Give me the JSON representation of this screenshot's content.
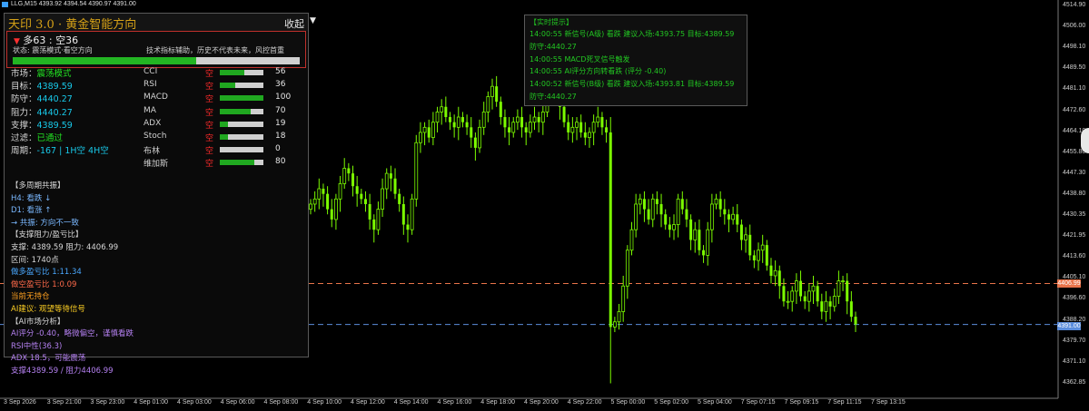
{
  "header": {
    "quote_line": "LLG,M15  4393.92 4394.54 4390.97 4391.00"
  },
  "price_axis": {
    "labels": [
      "4514.90",
      "4506.00",
      "4498.10",
      "4489.50",
      "4481.10",
      "4472.60",
      "4464.10",
      "4455.80",
      "4447.30",
      "4438.80",
      "4430.35",
      "4421.95",
      "4413.60",
      "4405.10",
      "4396.60",
      "4388.20",
      "4379.70",
      "4371.10",
      "4362.85"
    ],
    "tags": [
      {
        "label": "4406.99",
        "color": "#e8734a"
      },
      {
        "label": "4391.00",
        "color": "#5b8ddc"
      }
    ]
  },
  "time_axis": {
    "labels": [
      "3 Sep 2026",
      "3 Sep 21:00",
      "3 Sep 23:00",
      "4 Sep 01:00",
      "4 Sep 03:00",
      "4 Sep 06:00",
      "4 Sep 08:00",
      "4 Sep 10:00",
      "4 Sep 12:00",
      "4 Sep 14:00",
      "4 Sep 16:00",
      "4 Sep 18:00",
      "4 Sep 20:00",
      "4 Sep 22:00",
      "5 Sep 00:00",
      "5 Sep 02:00",
      "5 Sep 04:00",
      "7 Sep 07:15",
      "7 Sep 09:15",
      "7 Sep 11:15",
      "7 Sep 13:15"
    ]
  },
  "info_panel": {
    "title": "天印 3.0 · 黄金智能方向",
    "collapse_label": "收起",
    "dropdown_glyph": "▼",
    "sentiment": {
      "arrow": "▼",
      "ratio": "多63 : 空36",
      "status": "状态: 震荡模式·看空方向",
      "risk_note": "技术指标辅助，历史不代表未来，风控首重",
      "bull_fraction": 0.64
    },
    "summary_rows": [
      {
        "label": "市场：",
        "value": "震荡模式",
        "style": "val-green"
      },
      {
        "label": "目标：",
        "value": "4389.59",
        "style": "val"
      },
      {
        "label": "防守：",
        "value": "4440.27",
        "style": "val"
      },
      {
        "label": "阻力：",
        "value": "4440.27",
        "style": "val"
      },
      {
        "label": "支撑：",
        "value": "4389.59",
        "style": "val"
      },
      {
        "label": "过滤：",
        "value": "已通过",
        "style": "val-green"
      },
      {
        "label": "周期：",
        "value": "-167 | 1H空 4H空",
        "style": "val"
      }
    ],
    "indicators": [
      {
        "name": "CCI",
        "dir": "空",
        "value": "56",
        "fraction": 0.56
      },
      {
        "name": "RSI",
        "dir": "空",
        "value": "36",
        "fraction": 0.36
      },
      {
        "name": "MACD",
        "dir": "空",
        "value": "100",
        "fraction": 1.0
      },
      {
        "name": "MA",
        "dir": "空",
        "value": "70",
        "fraction": 0.7
      },
      {
        "name": "ADX",
        "dir": "空",
        "value": "19",
        "fraction": 0.19
      },
      {
        "name": "Stoch",
        "dir": "空",
        "value": "18",
        "fraction": 0.18
      },
      {
        "name": "布林",
        "dir": "空",
        "value": "0",
        "fraction": 0.0
      },
      {
        "name": "维加斯",
        "dir": "空",
        "value": "80",
        "fraction": 0.8
      }
    ],
    "lines": [
      {
        "text": "【多周期共振】",
        "color": "#d8d8d8"
      },
      {
        "text": "H4: 看跌 ↓",
        "color": "#7ab8ff"
      },
      {
        "text": "D1: 看涨 ↑",
        "color": "#7ab8ff"
      },
      {
        "text": "→ 共振: 方向不一致",
        "color": "#7ab8ff"
      },
      {
        "text": "【支撑阻力/盈亏比】",
        "color": "#d8d8d8"
      },
      {
        "text": "支撑: 4389.59 阻力: 4406.99",
        "color": "#d8d8d8"
      },
      {
        "text": "区间: 1740点",
        "color": "#d8d8d8"
      },
      {
        "text": "做多盈亏比 1:11.34",
        "color": "#4aa8ff"
      },
      {
        "text": "做空盈亏比 1:0.09",
        "color": "#ff6a4a"
      },
      {
        "text": "当前无持仓",
        "color": "#ffa020"
      },
      {
        "text": "AI建议: 观望等待信号",
        "color": "#ffd024"
      },
      {
        "text": "【AI市场分析】",
        "color": "#d8d8d8"
      },
      {
        "text": "AI评分 -0.40，略微偏空，谨慎看跌",
        "color": "#b480f0"
      },
      {
        "text": "RSI中性(36.3)",
        "color": "#b480f0"
      },
      {
        "text": "ADX 18.5，可能震荡",
        "color": "#b480f0"
      },
      {
        "text": "支撑4389.59 / 阻力4406.99",
        "color": "#b480f0"
      }
    ]
  },
  "alert_panel": {
    "title": "【实时提示】",
    "lines": [
      {
        "text": "14:00:55 新信号(A级) 看跌 建议入场:4393.75 目标:4389.59",
        "color": "#22c822"
      },
      {
        "text": "防守:4440.27",
        "color": "#22c822"
      },
      {
        "text": "14:00:55 MACD死叉信号触发",
        "color": "#22c822"
      },
      {
        "text": "14:00:55 AI评分方向转看跌 (评分 -0.40)",
        "color": "#22c822"
      },
      {
        "text": "14:00:52 新信号(B级) 看跌 建议入场:4393.81 目标:4389.59",
        "color": "#22c822"
      },
      {
        "text": "防守:4440.27",
        "color": "#22c822"
      }
    ]
  },
  "colors": {
    "bull_candle": "#7cfc00",
    "bear_candle": "#7cfc00",
    "resistance_line": "#e8734a",
    "support_line": "#5b8ddc"
  },
  "chart_data": {
    "type": "candlestick",
    "symbol": "LLG",
    "timeframe": "M15",
    "ylim": [
      4362.85,
      4514.9
    ],
    "hlines": [
      4406.99,
      4391.0
    ],
    "close": [
      4438,
      4440,
      4444,
      4442,
      4436,
      4432,
      4440,
      4446,
      4452,
      4450,
      4445,
      4442,
      4440,
      4438,
      4432,
      4428,
      4436,
      4444,
      4450,
      4448,
      4442,
      4438,
      4430,
      4428,
      4440,
      4462,
      4466,
      4468,
      4464,
      4470,
      4474,
      4476,
      4472,
      4470,
      4468,
      4472,
      4470,
      4468,
      4464,
      4460,
      4468,
      4474,
      4480,
      4484,
      4478,
      4472,
      4468,
      4466,
      4470,
      4472,
      4468,
      4466,
      4470,
      4472,
      4470,
      4474,
      4480,
      4486,
      4482,
      4476,
      4470,
      4466,
      4468,
      4470,
      4466,
      4464,
      4466,
      4470,
      4472,
      4468,
      4466,
      4390,
      4392,
      4396,
      4406,
      4420,
      4428,
      4438,
      4440,
      4436,
      4432,
      4440,
      4438,
      4434,
      4430,
      4428,
      4430,
      4440,
      4436,
      4432,
      4424,
      4428,
      4420,
      4418,
      4428,
      4438,
      4440,
      4436,
      4434,
      4432,
      4434,
      4430,
      4424,
      4426,
      4418,
      4416,
      4420,
      4422,
      4414,
      4410,
      4412,
      4406,
      4400,
      4400,
      4404,
      4408,
      4402,
      4400,
      4404,
      4406,
      4400,
      4396,
      4400,
      4398,
      4402,
      4408,
      4408,
      4400,
      4394,
      4391
    ]
  }
}
